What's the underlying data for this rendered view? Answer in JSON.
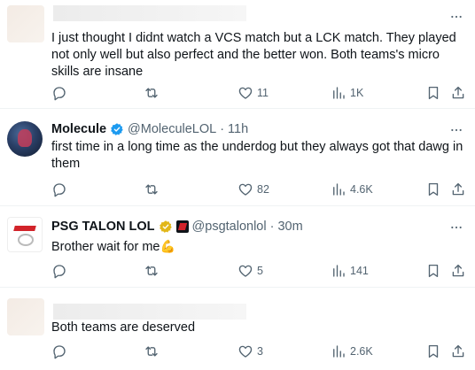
{
  "tweets": [
    {
      "author_name": "",
      "handle": "",
      "time": "",
      "text": "I just thought I didnt watch a VCS match but a LCK match. They played not only well but also perfect and the better won. Both teams's micro skills are insane",
      "likes": "11",
      "views": "1K",
      "retweets": "",
      "replies": ""
    },
    {
      "author_name": "Molecule",
      "handle": "@MoleculeLOL",
      "dot": "·",
      "time": "11h",
      "text": "first time in a long time as the underdog but they always got that dawg in them",
      "likes": "82",
      "views": "4.6K"
    },
    {
      "author_name": "PSG TALON LOL",
      "handle": "@psgtalonlol",
      "dot": "·",
      "time": "30m",
      "text": "Brother wait for me",
      "emoji": "💪",
      "likes": "5",
      "views": "141"
    },
    {
      "author_name": "",
      "text": "Both teams are deserved",
      "likes": "3",
      "views": "2.6K"
    }
  ],
  "colors": {
    "muted": "#536471",
    "text": "#0f1419",
    "verified_blue": "#1d9bf0",
    "verified_gold": "#e2b719",
    "divider": "#eff3f4"
  },
  "icons": [
    "reply-icon",
    "retweet-icon",
    "like-icon",
    "views-icon",
    "bookmark-icon",
    "share-icon",
    "more-icon",
    "verified-icon"
  ]
}
